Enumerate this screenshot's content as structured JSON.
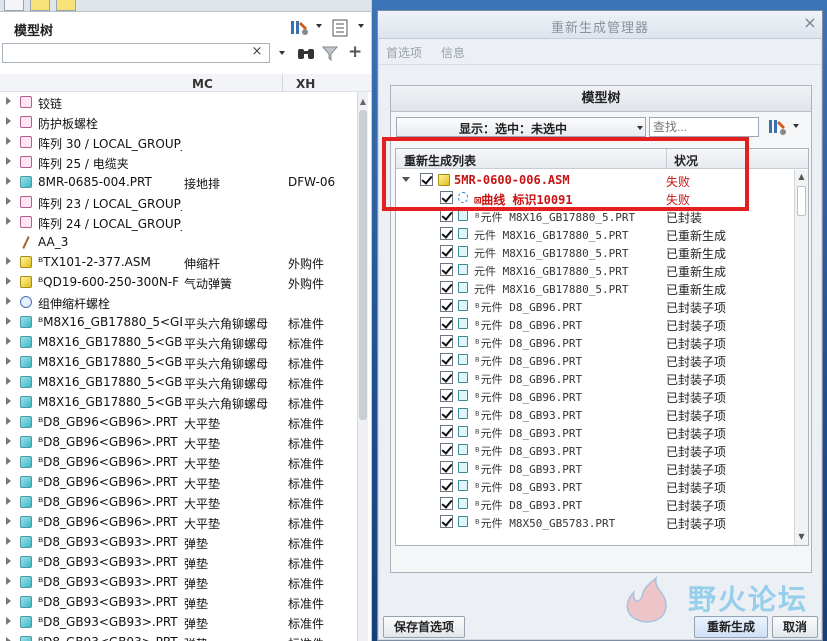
{
  "left_panel": {
    "title": "模型树",
    "search": {
      "value": "",
      "clear_label": "×"
    },
    "columns": {
      "mc": "MC",
      "xh": "XH"
    },
    "rows": [
      {
        "name": "铰链",
        "mc": "",
        "xh": "",
        "icon": "group"
      },
      {
        "name": "防护板螺栓",
        "mc": "",
        "xh": "",
        "icon": "group"
      },
      {
        "name": "阵列 30 / LOCAL_GROUP_",
        "mc": "",
        "xh": "",
        "icon": "group"
      },
      {
        "name": "阵列 25 / 电缆夹",
        "mc": "",
        "xh": "",
        "icon": "group"
      },
      {
        "name": "8MR-0685-004.PRT",
        "mc": "接地排",
        "xh": "DFW-06",
        "icon": "part"
      },
      {
        "name": "阵列 23 / LOCAL_GROUP_",
        "mc": "",
        "xh": "",
        "icon": "group"
      },
      {
        "name": "阵列 24 / LOCAL_GROUP_",
        "mc": "",
        "xh": "",
        "icon": "group"
      },
      {
        "name": "AA_3",
        "mc": "",
        "xh": "",
        "icon": "curve"
      },
      {
        "name": "ᴮTX101-2-377.ASM",
        "mc": "伸缩杆",
        "xh": "外购件",
        "icon": "asm"
      },
      {
        "name": "ᴮQD19-600-250-300N-F",
        "mc": "气动弹簧",
        "xh": "外购件",
        "icon": "asm"
      },
      {
        "name": "组伸缩杆螺栓",
        "mc": "",
        "xh": "",
        "icon": "flex"
      },
      {
        "name": "ᴮM8X16_GB17880_5<GB",
        "mc": "平头六角铆螺母",
        "xh": "标准件",
        "icon": "part"
      },
      {
        "name": "M8X16_GB17880_5<GB1",
        "mc": "平头六角铆螺母",
        "xh": "标准件",
        "icon": "part"
      },
      {
        "name": "M8X16_GB17880_5<GB1",
        "mc": "平头六角铆螺母",
        "xh": "标准件",
        "icon": "part"
      },
      {
        "name": "M8X16_GB17880_5<GB1",
        "mc": "平头六角铆螺母",
        "xh": "标准件",
        "icon": "part"
      },
      {
        "name": "M8X16_GB17880_5<GB1",
        "mc": "平头六角铆螺母",
        "xh": "标准件",
        "icon": "part"
      },
      {
        "name": "ᴮD8_GB96<GB96>.PRT",
        "mc": "大平垫",
        "xh": "标准件",
        "icon": "part"
      },
      {
        "name": "ᴮD8_GB96<GB96>.PRT",
        "mc": "大平垫",
        "xh": "标准件",
        "icon": "part"
      },
      {
        "name": "ᴮD8_GB96<GB96>.PRT",
        "mc": "大平垫",
        "xh": "标准件",
        "icon": "part"
      },
      {
        "name": "ᴮD8_GB96<GB96>.PRT",
        "mc": "大平垫",
        "xh": "标准件",
        "icon": "part"
      },
      {
        "name": "ᴮD8_GB96<GB96>.PRT",
        "mc": "大平垫",
        "xh": "标准件",
        "icon": "part"
      },
      {
        "name": "ᴮD8_GB96<GB96>.PRT",
        "mc": "大平垫",
        "xh": "标准件",
        "icon": "part"
      },
      {
        "name": "ᴮD8_GB93<GB93>.PRT",
        "mc": "弹垫",
        "xh": "标准件",
        "icon": "part"
      },
      {
        "name": "ᴮD8_GB93<GB93>.PRT",
        "mc": "弹垫",
        "xh": "标准件",
        "icon": "part"
      },
      {
        "name": "ᴮD8_GB93<GB93>.PRT",
        "mc": "弹垫",
        "xh": "标准件",
        "icon": "part"
      },
      {
        "name": "ᴮD8_GB93<GB93>.PRT",
        "mc": "弹垫",
        "xh": "标准件",
        "icon": "part"
      },
      {
        "name": "ᴮD8_GB93<GB93>.PRT",
        "mc": "弹垫",
        "xh": "标准件",
        "icon": "part"
      },
      {
        "name": "ᴮD8_GB93<GB93>.PRT",
        "mc": "弹垫",
        "xh": "标准件",
        "icon": "part"
      }
    ]
  },
  "dialog": {
    "title": "重新生成管理器",
    "close_label": "×",
    "menu": [
      "首选项",
      "信息"
    ],
    "pane_title": "模型树",
    "show_combo": "显示：选中：未选中",
    "find_placeholder": "查找...",
    "table": {
      "col_name": "重新生成列表",
      "col_status": "状况",
      "rows": [
        {
          "name": "5MR-0600-006.ASM",
          "status": "失败",
          "level": 0,
          "icon": "asm",
          "fail": true,
          "expand": true
        },
        {
          "name": "⊠曲线 标识10091",
          "status": "失败",
          "level": 1,
          "icon": "feat",
          "fail": true,
          "expand": false
        },
        {
          "name": "ᴮ元件 M8X16_GB17880_5.PRT",
          "status": "已封装",
          "level": 1,
          "icon": "part",
          "fail": false,
          "expand": false
        },
        {
          "name": "元件 M8X16_GB17880_5.PRT",
          "status": "已重新生成",
          "level": 1,
          "icon": "part",
          "fail": false,
          "expand": false
        },
        {
          "name": "元件 M8X16_GB17880_5.PRT",
          "status": "已重新生成",
          "level": 1,
          "icon": "part",
          "fail": false,
          "expand": false
        },
        {
          "name": "元件 M8X16_GB17880_5.PRT",
          "status": "已重新生成",
          "level": 1,
          "icon": "part",
          "fail": false,
          "expand": false
        },
        {
          "name": "元件 M8X16_GB17880_5.PRT",
          "status": "已重新生成",
          "level": 1,
          "icon": "part",
          "fail": false,
          "expand": false
        },
        {
          "name": "ᴮ元件 D8_GB96.PRT",
          "status": "已封装子项",
          "level": 1,
          "icon": "part",
          "fail": false,
          "expand": false
        },
        {
          "name": "ᴮ元件 D8_GB96.PRT",
          "status": "已封装子项",
          "level": 1,
          "icon": "part",
          "fail": false,
          "expand": false
        },
        {
          "name": "ᴮ元件 D8_GB96.PRT",
          "status": "已封装子项",
          "level": 1,
          "icon": "part",
          "fail": false,
          "expand": false
        },
        {
          "name": "ᴮ元件 D8_GB96.PRT",
          "status": "已封装子项",
          "level": 1,
          "icon": "part",
          "fail": false,
          "expand": false
        },
        {
          "name": "ᴮ元件 D8_GB96.PRT",
          "status": "已封装子项",
          "level": 1,
          "icon": "part",
          "fail": false,
          "expand": false
        },
        {
          "name": "ᴮ元件 D8_GB96.PRT",
          "status": "已封装子项",
          "level": 1,
          "icon": "part",
          "fail": false,
          "expand": false
        },
        {
          "name": "ᴮ元件 D8_GB93.PRT",
          "status": "已封装子项",
          "level": 1,
          "icon": "part",
          "fail": false,
          "expand": false
        },
        {
          "name": "ᴮ元件 D8_GB93.PRT",
          "status": "已封装子项",
          "level": 1,
          "icon": "part",
          "fail": false,
          "expand": false
        },
        {
          "name": "ᴮ元件 D8_GB93.PRT",
          "status": "已封装子项",
          "level": 1,
          "icon": "part",
          "fail": false,
          "expand": false
        },
        {
          "name": "ᴮ元件 D8_GB93.PRT",
          "status": "已封装子项",
          "level": 1,
          "icon": "part",
          "fail": false,
          "expand": false
        },
        {
          "name": "ᴮ元件 D8_GB93.PRT",
          "status": "已封装子项",
          "level": 1,
          "icon": "part",
          "fail": false,
          "expand": false
        },
        {
          "name": "ᴮ元件 D8_GB93.PRT",
          "status": "已封装子项",
          "level": 1,
          "icon": "part",
          "fail": false,
          "expand": false
        },
        {
          "name": "ᴮ元件 M8X50_GB5783.PRT",
          "status": "已封装子项",
          "level": 1,
          "icon": "part",
          "fail": false,
          "expand": false
        }
      ]
    },
    "buttons": {
      "save": "保存首选项",
      "regen": "重新生成",
      "cancel": "取消"
    }
  },
  "watermark": "野火论坛",
  "colors": {
    "fail": "#c81414",
    "highlight": "#e3201f",
    "desktop": "#1e4f8f"
  }
}
